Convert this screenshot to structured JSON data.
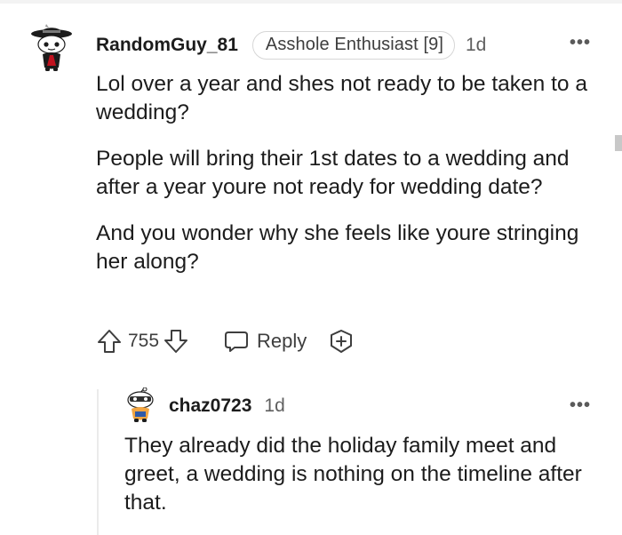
{
  "comment": {
    "username": "RandomGuy_81",
    "flair": "Asshole Enthusiast [9]",
    "age": "1d",
    "more_label": "•••",
    "avatar_icon": "snoo-avatar-icon",
    "paragraphs": [
      "Lol over a year and shes not ready to be taken to a wedding?",
      "People will bring their 1st dates to a wedding and after a year youre not ready for wedding date?",
      "And you wonder why she feels like youre stringing her along?"
    ],
    "actions": {
      "upvote_icon": "upvote-arrow-icon",
      "vote_count": "755",
      "downvote_icon": "downvote-arrow-icon",
      "reply_icon": "chat-bubble-icon",
      "reply_label": "Reply",
      "award_icon": "award-plus-icon"
    }
  },
  "reply": {
    "username": "chaz0723",
    "age": "1d",
    "more_label": "•••",
    "avatar_icon": "snoo-avatar-icon",
    "text": "They already did the holiday family meet and greet, a wedding is nothing on the timeline after that."
  },
  "colors": {
    "text": "#1c1c1c",
    "meta": "#5f5f5f",
    "icon": "#3e3e3e",
    "flair_border": "#d6d6d6",
    "thread_line": "#ebebeb"
  }
}
